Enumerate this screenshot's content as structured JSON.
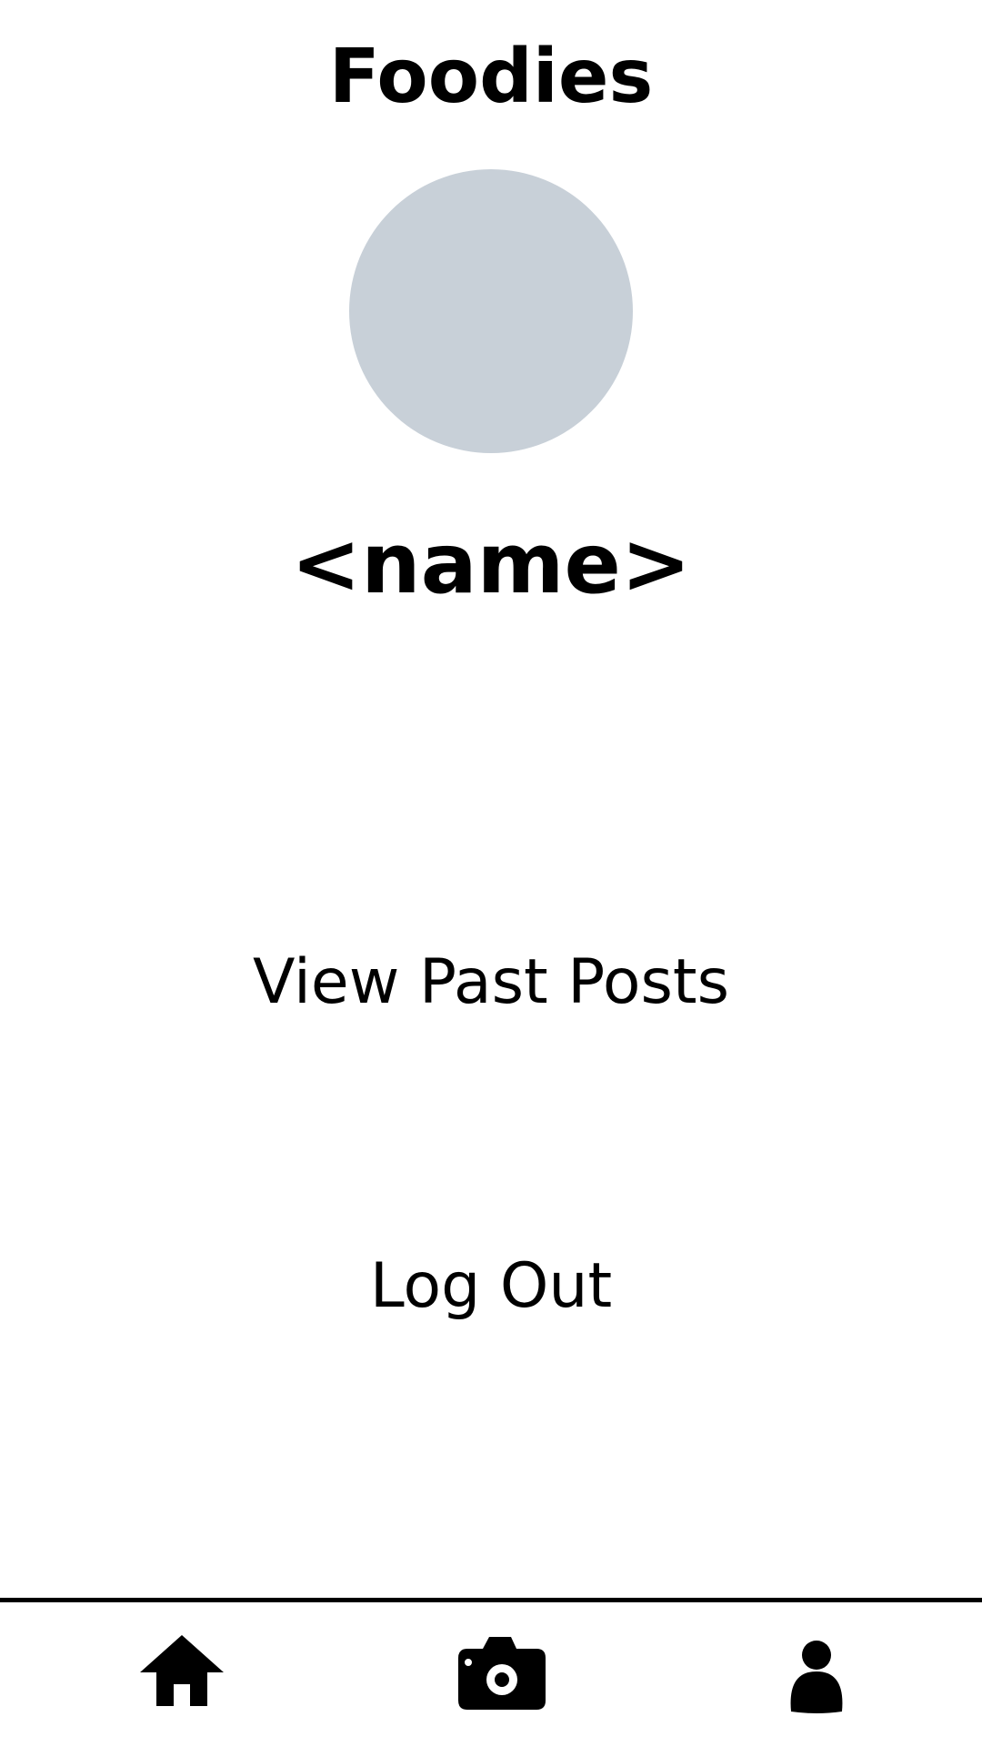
{
  "header": {
    "title": "Foodies"
  },
  "profile": {
    "avatar_color": "#c8d0d8",
    "name": "<name>"
  },
  "menu": {
    "view_past_posts_label": "View Past Posts",
    "log_out_label": "Log Out"
  },
  "bottom_nav": {
    "items": [
      {
        "icon": "home-icon"
      },
      {
        "icon": "camera-icon"
      },
      {
        "icon": "person-icon"
      }
    ]
  }
}
